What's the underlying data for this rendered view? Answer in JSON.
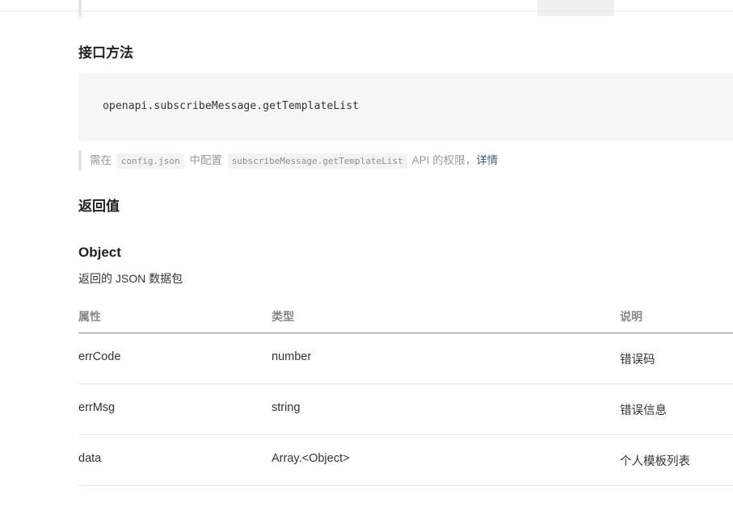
{
  "sections": {
    "method_heading": "接口方法",
    "method_code": "openapi.subscribeMessage.getTemplateList",
    "note": {
      "prefix": "需在",
      "code1": "config.json",
      "middle": "中配置",
      "code2": "subscribeMessage.getTemplateList",
      "suffix": "API 的权限，",
      "link": "详情"
    },
    "return_heading": "返回值",
    "object_heading": "Object",
    "object_desc": "返回的 JSON 数据包"
  },
  "table": {
    "headers": [
      "属性",
      "类型",
      "说明"
    ],
    "rows": [
      {
        "name": "errCode",
        "type": "number",
        "desc": "错误码"
      },
      {
        "name": "errMsg",
        "type": "string",
        "desc": "错误信息"
      },
      {
        "name": "data",
        "type": "Array.<Object>",
        "desc": "个人模板列表"
      }
    ]
  },
  "colors": {
    "link": "#3a5a8a",
    "code_bg": "#f6f6f6",
    "header_text": "#888888"
  }
}
